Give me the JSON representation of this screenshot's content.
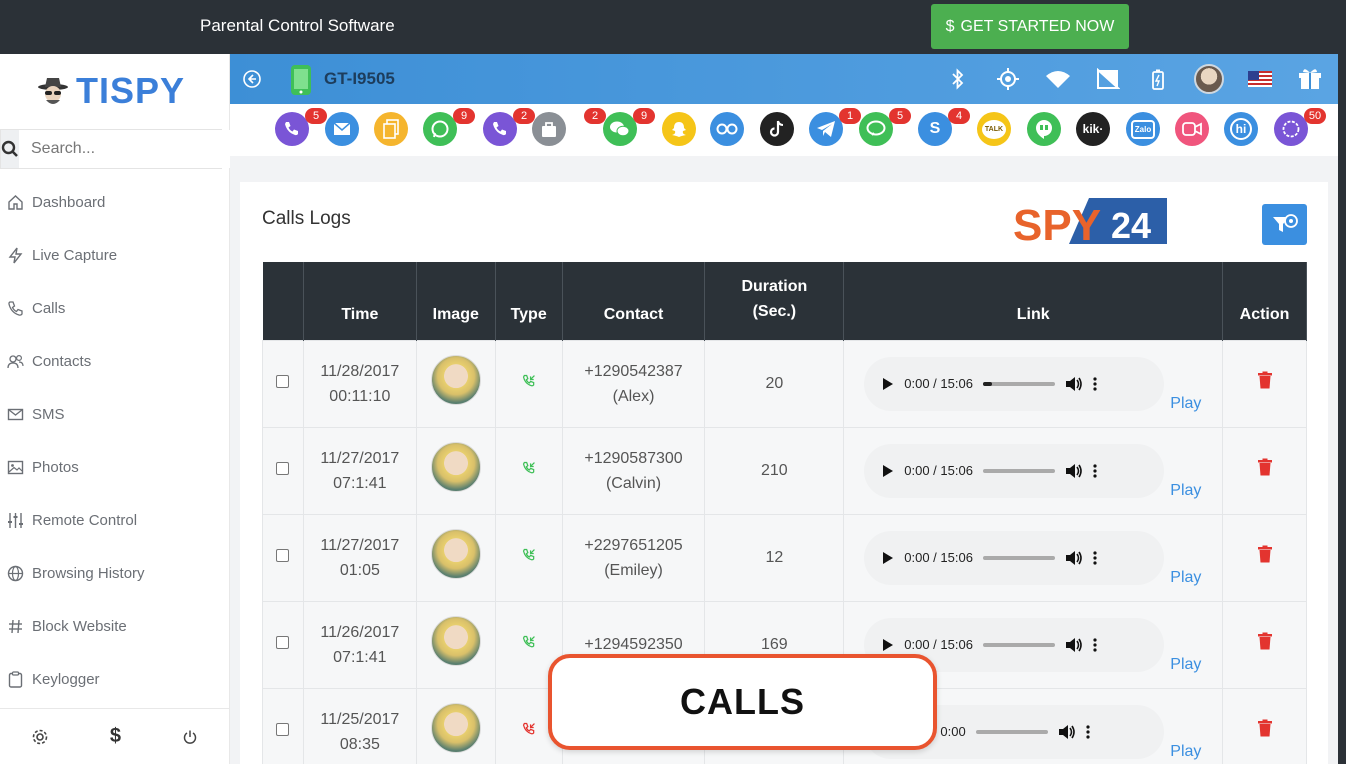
{
  "banner": {
    "title": "Parental Control Software",
    "cta_label": "GET STARTED NOW",
    "cta_color": "#4caf50"
  },
  "sidebar": {
    "logo_text": "TISPY",
    "search_placeholder": "Search...",
    "items": [
      {
        "label": "Dashboard",
        "icon": "home-icon"
      },
      {
        "label": "Live Capture",
        "icon": "bolt-icon"
      },
      {
        "label": "Calls",
        "icon": "phone-icon"
      },
      {
        "label": "Contacts",
        "icon": "users-icon"
      },
      {
        "label": "SMS",
        "icon": "envelope-icon"
      },
      {
        "label": "Photos",
        "icon": "image-icon"
      },
      {
        "label": "Remote Control",
        "icon": "sliders-icon"
      },
      {
        "label": "Browsing History",
        "icon": "globe-icon"
      },
      {
        "label": "Block Website",
        "icon": "hash-icon"
      },
      {
        "label": "Keylogger",
        "icon": "clipboard-icon"
      }
    ]
  },
  "device": {
    "model": "GT-I9505",
    "header_color": "#3d8fd6"
  },
  "apps": [
    {
      "name": "phone",
      "badge": "5"
    },
    {
      "name": "email",
      "badge": ""
    },
    {
      "name": "files",
      "badge": ""
    },
    {
      "name": "whatsapp",
      "badge": "9"
    },
    {
      "name": "viber",
      "badge": "2"
    },
    {
      "name": "bag",
      "badge": "2"
    },
    {
      "name": "wechat",
      "badge": "9"
    },
    {
      "name": "snapchat",
      "badge": ""
    },
    {
      "name": "flickr",
      "badge": ""
    },
    {
      "name": "tiktok",
      "badge": ""
    },
    {
      "name": "telegram",
      "badge": "1"
    },
    {
      "name": "line",
      "badge": "5"
    },
    {
      "name": "skype",
      "badge": "4"
    },
    {
      "name": "kakaotalk",
      "badge": ""
    },
    {
      "name": "hangouts",
      "badge": ""
    },
    {
      "name": "kik",
      "badge": ""
    },
    {
      "name": "zalo",
      "badge": ""
    },
    {
      "name": "video-chat",
      "badge": ""
    },
    {
      "name": "hike",
      "badge": ""
    },
    {
      "name": "signal",
      "badge": "50"
    }
  ],
  "main": {
    "title": "Calls Logs",
    "spy24_logo_text": "SPY24",
    "columns": [
      "",
      "Time",
      "Image",
      "Type",
      "Contact",
      "Duration (Sec.)",
      "Link",
      "Action"
    ],
    "play_label": "Play",
    "rows": [
      {
        "date": "11/28/2017",
        "time": "00:11:10",
        "type": "incoming",
        "number": "+1290542387",
        "name": "(Alex)",
        "duration": "20",
        "audio_time": "0:00 / 15:06",
        "progress": 0.12
      },
      {
        "date": "11/27/2017",
        "time": "07:1:41",
        "type": "incoming",
        "number": "+1290587300",
        "name": "(Calvin)",
        "duration": "210",
        "audio_time": "0:00 / 15:06",
        "progress": 0
      },
      {
        "date": "11/27/2017",
        "time": "01:05",
        "type": "incoming",
        "number": "+2297651205",
        "name": "(Emiley)",
        "duration": "12",
        "audio_time": "0:00 / 15:06",
        "progress": 0
      },
      {
        "date": "11/26/2017",
        "time": "07:1:41",
        "type": "incoming",
        "number": "+1294592350",
        "name": "",
        "duration": "169",
        "audio_time": "0:00 / 15:06",
        "progress": 0
      },
      {
        "date": "11/25/2017",
        "time": "08:35",
        "type": "missed",
        "number": "",
        "name": "",
        "duration": "",
        "audio_time": "0:00 / 0:00",
        "progress": 0
      }
    ]
  },
  "overlay": {
    "label": "CALLS",
    "border_color": "#e9542f"
  }
}
